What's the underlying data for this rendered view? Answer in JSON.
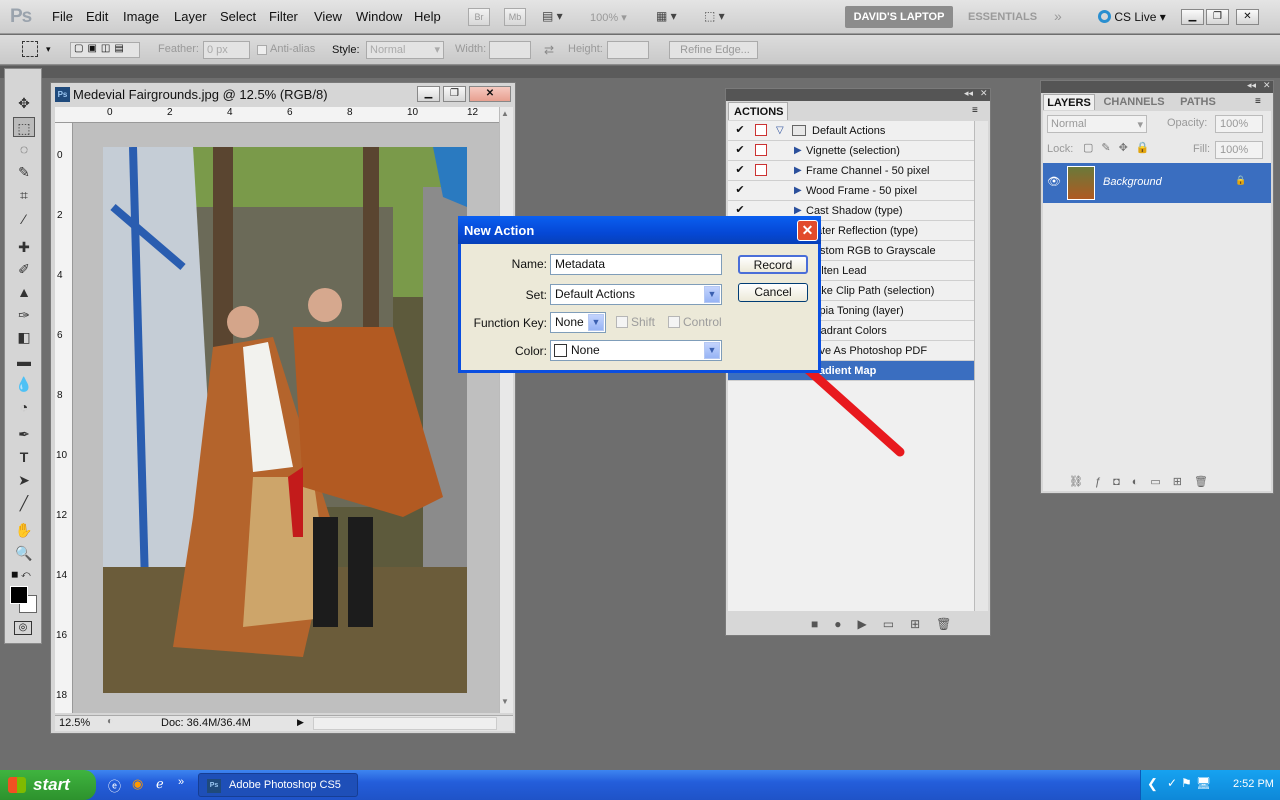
{
  "app": {
    "logo": "Ps",
    "menus": [
      "File",
      "Edit",
      "Image",
      "Layer",
      "Select",
      "Filter",
      "View",
      "Window",
      "Help"
    ],
    "zoom_readout": "100%",
    "workspace_active": "DAVID'S LAPTOP",
    "workspace_other": "ESSENTIALS",
    "cs_live": "CS Live"
  },
  "options_bar": {
    "feather_label": "Feather:",
    "feather_value": "0 px",
    "antialias_label": "Anti-alias",
    "style_label": "Style:",
    "style_value": "Normal",
    "width_label": "Width:",
    "height_label": "Height:",
    "refine_edge": "Refine Edge..."
  },
  "document": {
    "title": "Medevial Fairgrounds.jpg @ 12.5% (RGB/8)",
    "zoom": "12.5%",
    "doc_size": "Doc: 36.4M/36.4M",
    "ruler_top": [
      "0",
      "2",
      "4",
      "6",
      "8",
      "10",
      "12"
    ],
    "ruler_left": [
      "0",
      "2",
      "4",
      "6",
      "8",
      "10",
      "12",
      "14",
      "16",
      "18"
    ]
  },
  "actions_panel": {
    "tab": "ACTIONS",
    "set_name": "Default Actions",
    "items": [
      "Vignette (selection)",
      "Frame Channel - 50 pixel",
      "Wood Frame - 50 pixel",
      "Cast Shadow (type)",
      "Water Reflection (type)",
      "Custom RGB to Grayscale",
      "Molten Lead",
      "Make Clip Path (selection)",
      "Sepia Toning (layer)",
      "Quadrant Colors",
      "Save As Photoshop PDF",
      "Gradient Map"
    ],
    "selected_item": "Gradient Map"
  },
  "layers_panel": {
    "tabs": [
      "LAYERS",
      "CHANNELS",
      "PATHS"
    ],
    "blend_mode": "Normal",
    "opacity_label": "Opacity:",
    "opacity_value": "100%",
    "lock_label": "Lock:",
    "fill_label": "Fill:",
    "fill_value": "100%",
    "layer_name": "Background"
  },
  "dialog": {
    "title": "New Action",
    "name_label": "Name:",
    "name_value": "Metadata",
    "set_label": "Set:",
    "set_value": "Default Actions",
    "fkey_label": "Function Key:",
    "fkey_value": "None",
    "shift_label": "Shift",
    "control_label": "Control",
    "color_label": "Color:",
    "color_value": "None",
    "record_button": "Record",
    "cancel_button": "Cancel"
  },
  "taskbar": {
    "start": "start",
    "task": "Adobe Photoshop CS5",
    "clock": "2:52 PM"
  },
  "colors": {
    "xp_blue": "#0548d6",
    "selection_blue": "#3a6ec0",
    "arrow_red": "#e8191e"
  }
}
